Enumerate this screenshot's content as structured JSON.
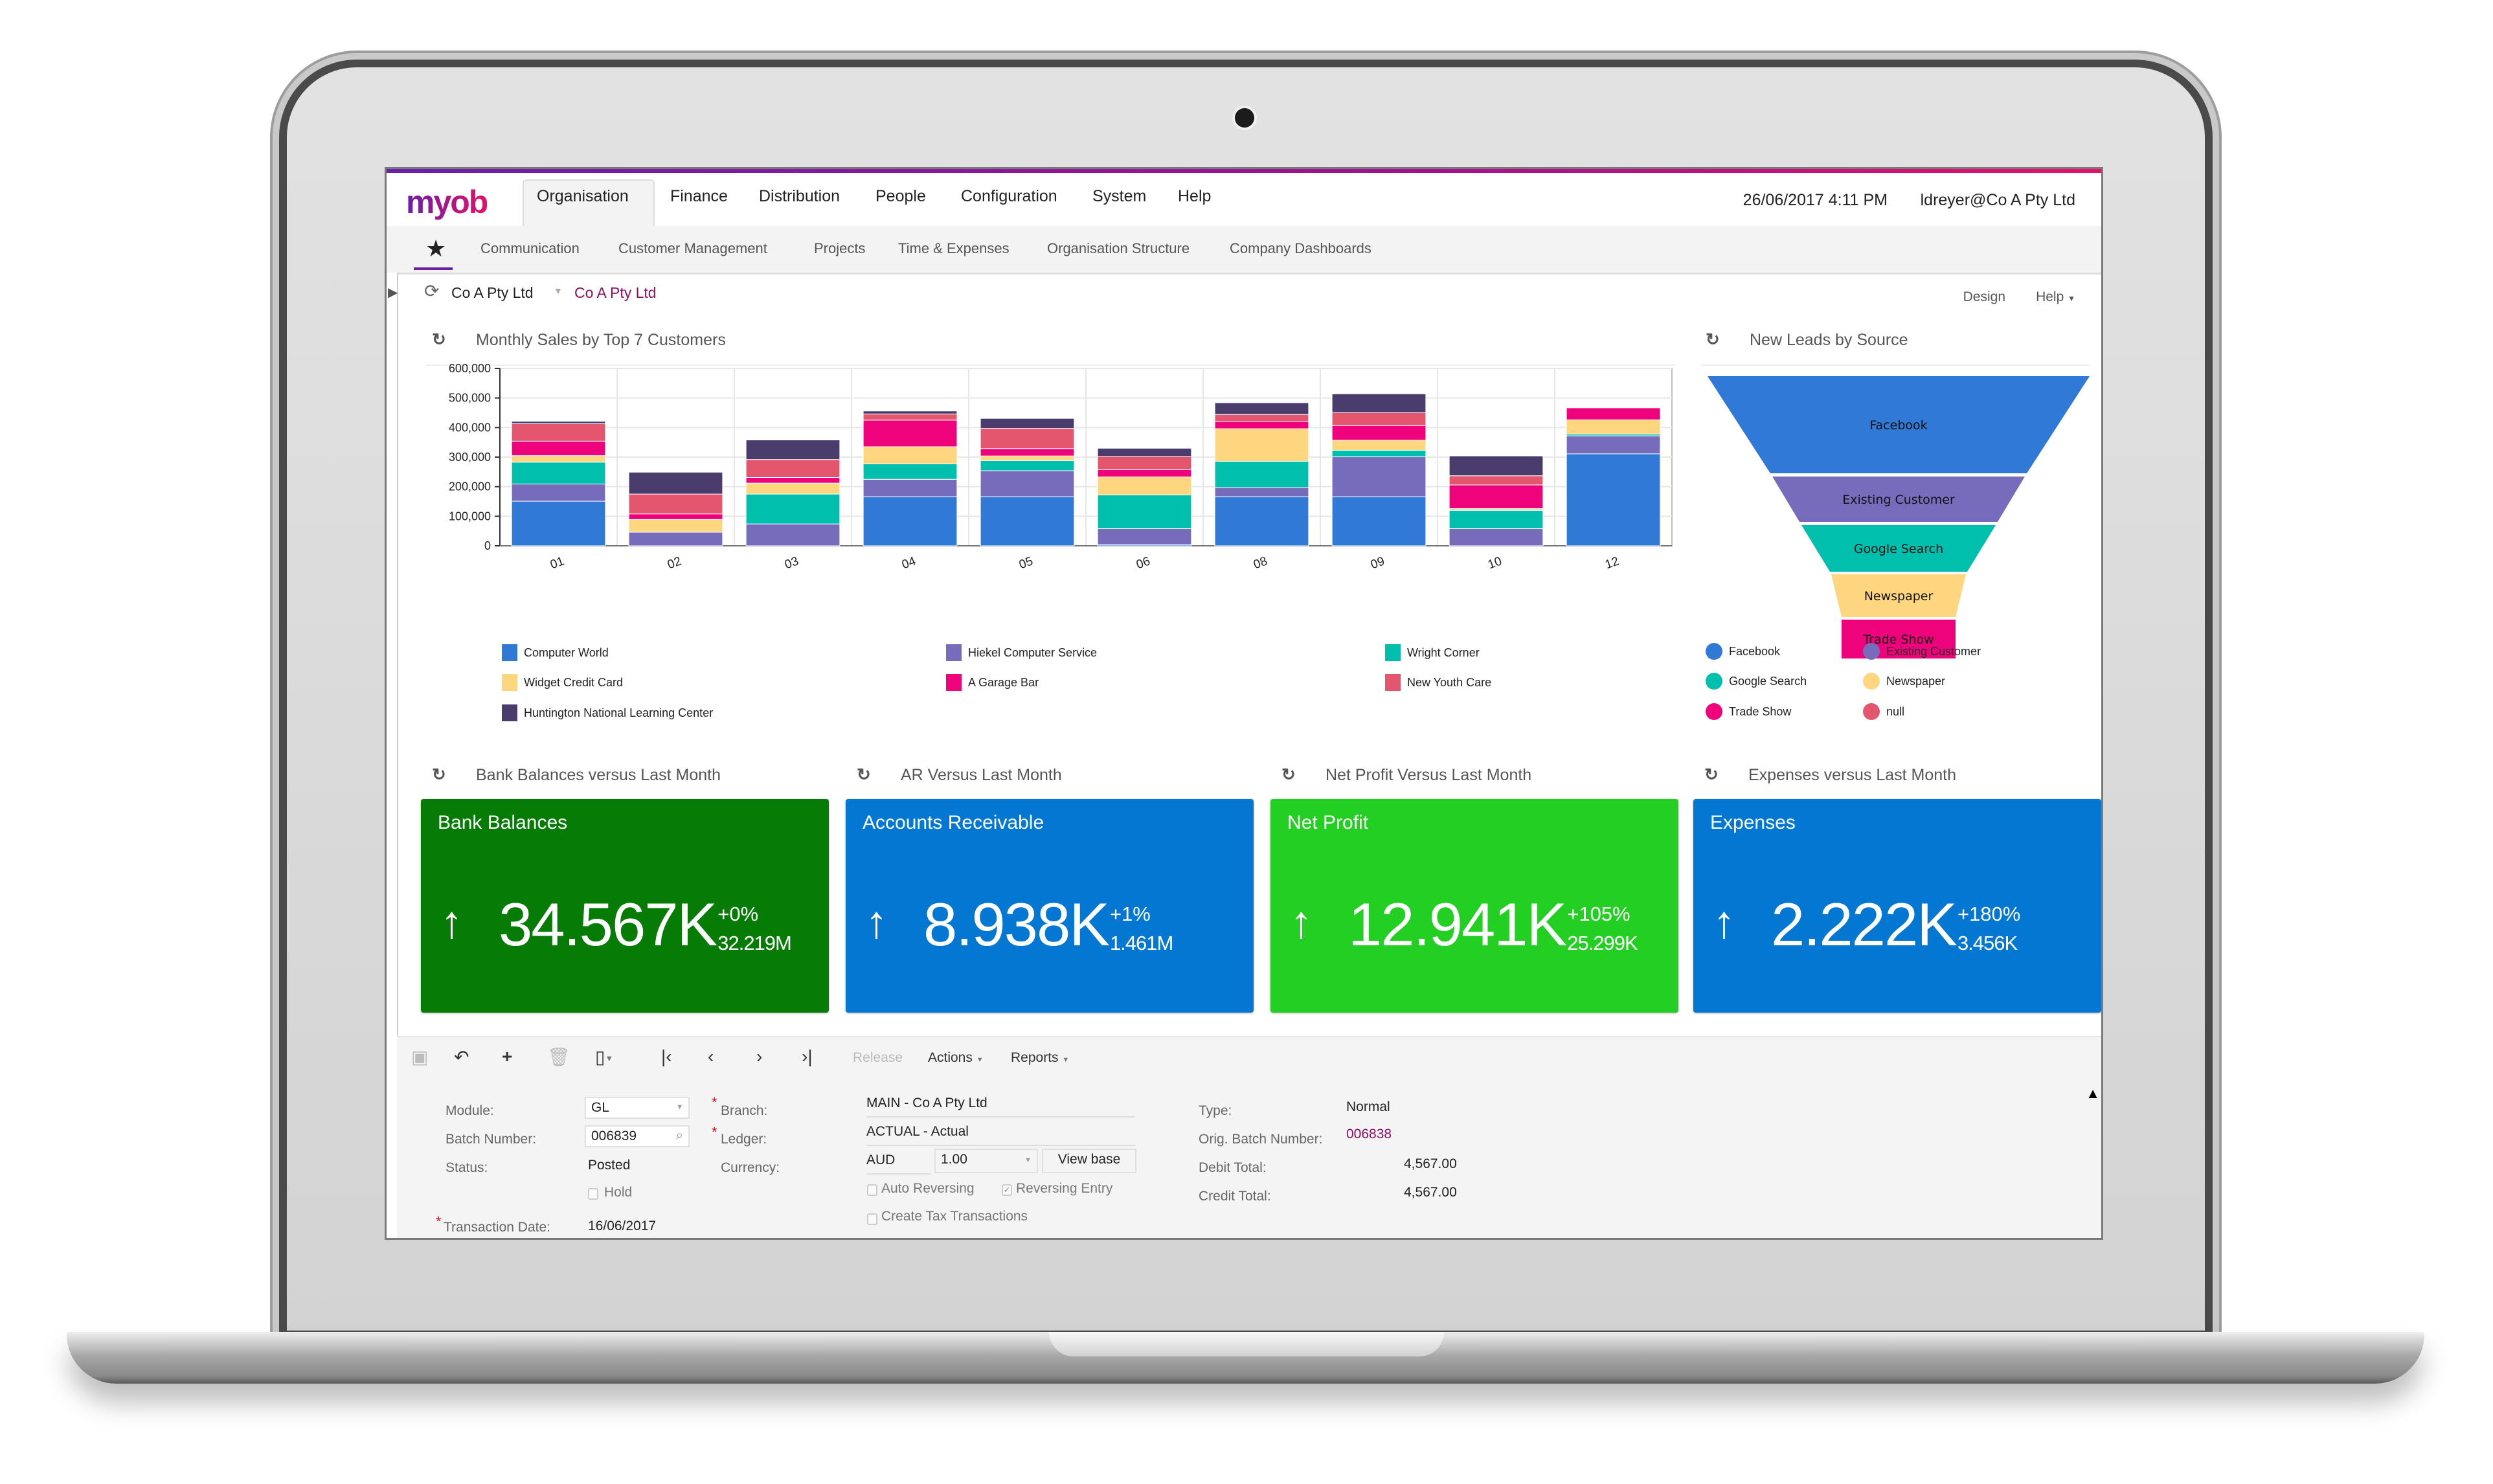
{
  "app": {
    "logo": "myob",
    "datetime": "26/06/2017  4:11 PM",
    "user": "ldreyer@Co A Pty Ltd",
    "brand_colors": {
      "purple": "#6b1fa8",
      "magenta": "#e5106b",
      "link": "#8e1064"
    }
  },
  "topnav": {
    "items": [
      "Organisation",
      "Finance",
      "Distribution",
      "People",
      "Configuration",
      "System",
      "Help"
    ],
    "active": "Organisation"
  },
  "subnav": {
    "favorites_icon": "star-icon",
    "items": [
      "Communication",
      "Customer Management",
      "Projects",
      "Time & Expenses",
      "Organisation Structure",
      "Company Dashboards"
    ]
  },
  "breadcrumb": {
    "company": "Co A Pty Ltd",
    "active": "Co A Pty Ltd",
    "design": "Design",
    "help": "Help"
  },
  "widgets": {
    "sales_title": "Monthly Sales by Top 7 Customers",
    "leads_title": "New Leads by Source"
  },
  "chart_data": [
    {
      "type": "bar",
      "stacked": true,
      "title": "Monthly Sales by Top 7 Customers",
      "xlabel": "",
      "ylabel": "",
      "categories": [
        "01",
        "02",
        "03",
        "04",
        "05",
        "06",
        "08",
        "09",
        "10",
        "12"
      ],
      "ylim": [
        0,
        600000
      ],
      "yticks": [
        0,
        100000,
        200000,
        300000,
        400000,
        500000,
        600000
      ],
      "ytick_labels": [
        "0",
        "100,000",
        "200,000",
        "300,000",
        "400,000",
        "500,000",
        "600,000"
      ],
      "grid": true,
      "legend_position": "bottom",
      "series": [
        {
          "name": "Computer World",
          "color": "#3079d6",
          "values": [
            151000,
            0,
            0,
            166000,
            166000,
            5000,
            166000,
            166000,
            0,
            311000
          ]
        },
        {
          "name": "Hiekel Computer Service",
          "color": "#766cbb",
          "values": [
            58000,
            46000,
            74000,
            59000,
            88000,
            53000,
            31000,
            135000,
            58000,
            61000
          ]
        },
        {
          "name": "Wright Corner",
          "color": "#00bfad",
          "values": [
            74000,
            0,
            101000,
            52000,
            34000,
            114000,
            89000,
            22000,
            62000,
            6000
          ]
        },
        {
          "name": "Widget Credit Card",
          "color": "#ffd680",
          "values": [
            22000,
            43000,
            37000,
            58000,
            16000,
            61000,
            110000,
            34000,
            6000,
            48000
          ]
        },
        {
          "name": "A Garage Bar",
          "color": "#ef037c",
          "values": [
            49000,
            19000,
            19000,
            90000,
            25000,
            25000,
            25000,
            50000,
            80000,
            41000
          ]
        },
        {
          "name": "New Youth Care",
          "color": "#e4566e",
          "values": [
            59000,
            67000,
            61000,
            21000,
            68000,
            44000,
            23000,
            43000,
            31000,
            2000
          ]
        },
        {
          "name": "Huntington National Learning Center",
          "color": "#4a3c6d",
          "values": [
            8000,
            74000,
            66000,
            10000,
            34000,
            28000,
            40000,
            64000,
            67000,
            0
          ]
        }
      ]
    },
    {
      "type": "funnel",
      "title": "New Leads by Source",
      "legend_position": "bottom",
      "stages": [
        {
          "name": "Facebook",
          "color": "#3079d6"
        },
        {
          "name": "Existing Customer",
          "color": "#766cbb"
        },
        {
          "name": "Google Search",
          "color": "#00bfad"
        },
        {
          "name": "Newspaper",
          "color": "#ffd680"
        },
        {
          "name": "Trade Show",
          "color": "#ef037c"
        }
      ],
      "legend": [
        {
          "name": "Facebook",
          "color": "#3079d6"
        },
        {
          "name": "Existing Customer",
          "color": "#766cbb"
        },
        {
          "name": "Google Search",
          "color": "#00bfad"
        },
        {
          "name": "Newspaper",
          "color": "#ffd680"
        },
        {
          "name": "Trade Show",
          "color": "#ef037c"
        },
        {
          "name": "null",
          "color": "#e4566e"
        }
      ]
    }
  ],
  "kpis": [
    {
      "widget_title": "Bank Balances versus Last Month",
      "title": "Bank Balances",
      "value": "34.567K",
      "change": "+0%",
      "previous": "32.219M",
      "color": "#067c06",
      "trend": "up"
    },
    {
      "widget_title": "AR Versus Last Month",
      "title": "Accounts Receivable",
      "value": "8.938K",
      "change": "+1%",
      "previous": "1.461M",
      "color": "#0477d3",
      "trend": "up"
    },
    {
      "widget_title": "Net Profit Versus Last Month",
      "title": "Net Profit",
      "value": "12.941K",
      "change": "+105%",
      "previous": "25.299K",
      "color": "#22cf22",
      "trend": "up"
    },
    {
      "widget_title": "Expenses versus Last Month",
      "title": "Expenses",
      "value": "2.222K",
      "change": "+180%",
      "previous": "3.456K",
      "color": "#0477d3",
      "trend": "up"
    }
  ],
  "toolbar": {
    "release": "Release",
    "actions": "Actions",
    "reports": "Reports"
  },
  "form": {
    "module_label": "Module:",
    "module_value": "GL",
    "batch_label": "Batch Number:",
    "batch_value": "006839",
    "status_label": "Status:",
    "status_value": "Posted",
    "hold_label": "Hold",
    "hold_checked": false,
    "trandate_label": "Transaction Date:",
    "trandate_value": "16/06/2017",
    "branch_label": "Branch:",
    "branch_value": "MAIN - Co A Pty Ltd",
    "ledger_label": "Ledger:",
    "ledger_value": "ACTUAL - Actual",
    "currency_label": "Currency:",
    "currency_value": "AUD",
    "rate_value": "1.00",
    "view_base": "View base",
    "auto_reversing_label": "Auto Reversing",
    "auto_reversing_checked": false,
    "reversing_entry_label": "Reversing Entry",
    "reversing_entry_checked": true,
    "create_tax_label": "Create Tax Transactions",
    "create_tax_checked": false,
    "type_label": "Type:",
    "type_value": "Normal",
    "orig_batch_label": "Orig. Batch Number:",
    "orig_batch_value": "006838",
    "debit_label": "Debit Total:",
    "debit_value": "4,567.00",
    "credit_label": "Credit Total:",
    "credit_value": "4,567.00"
  }
}
